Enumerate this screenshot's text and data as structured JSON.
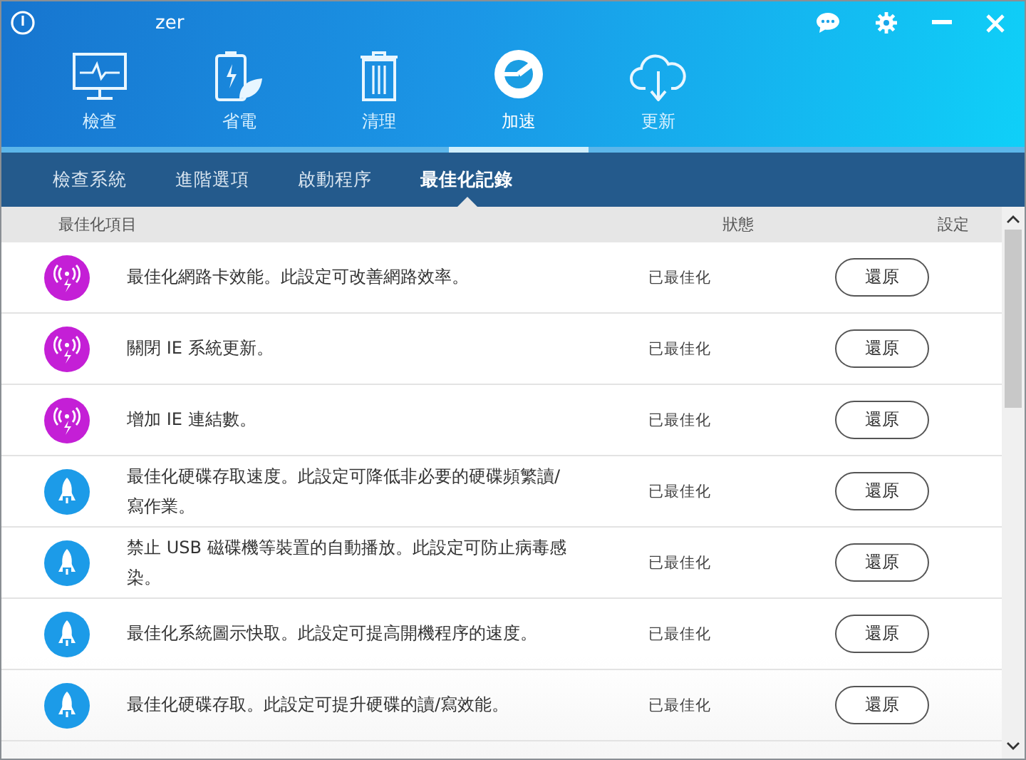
{
  "window": {
    "title": "zer"
  },
  "title_bar_buttons": [
    {
      "kind": "chat"
    },
    {
      "kind": "settings"
    },
    {
      "kind": "minimize"
    },
    {
      "kind": "close"
    }
  ],
  "nav": [
    {
      "label": "檢查",
      "kind": "monitor",
      "selected": false
    },
    {
      "label": "省電",
      "kind": "battery",
      "selected": false
    },
    {
      "label": "清理",
      "kind": "trash",
      "selected": false
    },
    {
      "label": "加速",
      "kind": "speed",
      "selected": true
    },
    {
      "label": "更新",
      "kind": "cloud",
      "selected": false
    }
  ],
  "tabs": [
    {
      "label": "檢查系統",
      "selected": false
    },
    {
      "label": "進階選項",
      "selected": false
    },
    {
      "label": "啟動程序",
      "selected": false
    },
    {
      "label": "最佳化記錄",
      "selected": true
    }
  ],
  "table": {
    "columns": [
      "最佳化項目",
      "狀態",
      "設定"
    ],
    "rows": [
      {
        "kind": "network",
        "item": "最佳化網路卡效能。此設定可改善網路效率。",
        "status": "已最佳化",
        "action": "還原"
      },
      {
        "kind": "network",
        "item": "關閉 IE 系統更新。",
        "status": "已最佳化",
        "action": "還原"
      },
      {
        "kind": "network",
        "item": "增加 IE 連結數。",
        "status": "已最佳化",
        "action": "還原"
      },
      {
        "kind": "rocket",
        "item": "最佳化硬碟存取速度。此設定可降低非必要的硬碟頻繁讀/寫作業。",
        "status": "已最佳化",
        "action": "還原"
      },
      {
        "kind": "rocket",
        "item": "禁止 USB 磁碟機等裝置的自動播放。此設定可防止病毒感染。",
        "status": "已最佳化",
        "action": "還原"
      },
      {
        "kind": "rocket",
        "item": "最佳化系統圖示快取。此設定可提高開機程序的速度。",
        "status": "已最佳化",
        "action": "還原"
      },
      {
        "kind": "rocket",
        "item": "最佳化硬碟存取。此設定可提升硬碟的讀/寫效能。",
        "status": "已最佳化",
        "action": "還原"
      }
    ]
  }
}
